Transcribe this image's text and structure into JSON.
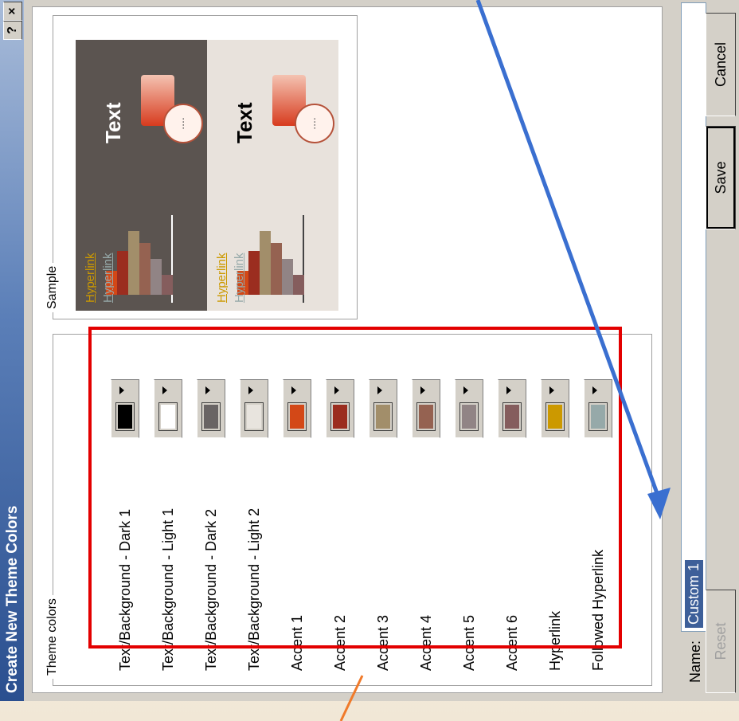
{
  "dialog": {
    "title": "Create New Theme Colors",
    "help_glyph": "?",
    "close_glyph": "×"
  },
  "theme_colors": {
    "legend": "Theme colors",
    "items": [
      {
        "label": "Text/Background - Dark 1",
        "color": "#000000"
      },
      {
        "label": "Text/Background - Light 1",
        "color": "#ffffff"
      },
      {
        "label": "Text/Background - Dark 2",
        "color": "#696464"
      },
      {
        "label": "Text/Background - Light 2",
        "color": "#e8e4de"
      },
      {
        "label": "Accent 1",
        "color": "#d34817"
      },
      {
        "label": "Accent 2",
        "color": "#9b2d1f"
      },
      {
        "label": "Accent 3",
        "color": "#a28e6a"
      },
      {
        "label": "Accent 4",
        "color": "#956251"
      },
      {
        "label": "Accent 5",
        "color": "#918485"
      },
      {
        "label": "Accent 6",
        "color": "#855d5d"
      },
      {
        "label": "Hyperlink",
        "color": "#cc9900"
      },
      {
        "label": "Followed Hyperlink",
        "color": "#96a9a9"
      }
    ]
  },
  "sample": {
    "legend": "Sample",
    "dark_text": "Text",
    "light_text": "Text",
    "hyperlink": "Hyperlink",
    "followed_hyperlink": "Hyperlink",
    "shape_glyph": "....",
    "dark_bg": "#5b5450",
    "light_bg": "#e8e2dc"
  },
  "name": {
    "label": "Name:",
    "value": "Custom 1"
  },
  "buttons": {
    "reset": "Reset",
    "save": "Save",
    "cancel": "Cancel"
  },
  "annotations": {
    "arrow_color": "#3a6fd0",
    "highlight_color": "#e30000",
    "line_color": "#f07a2a"
  }
}
